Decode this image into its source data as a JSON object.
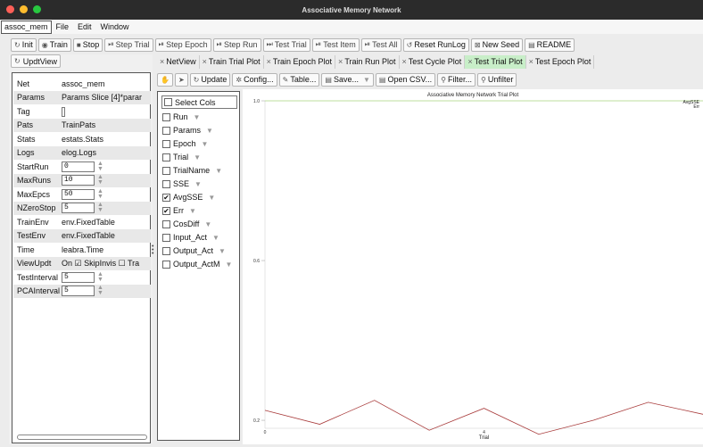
{
  "window": {
    "title": "Associative Memory Network"
  },
  "menu": {
    "app": "assoc_mem",
    "items": [
      "File",
      "Edit",
      "Window"
    ]
  },
  "toolbar": [
    {
      "icon": "refresh-icon",
      "glyph": "↻",
      "label": "Init",
      "enabled": true
    },
    {
      "icon": "play-icon",
      "glyph": "◉",
      "label": "Train",
      "enabled": true
    },
    {
      "icon": "stop-icon",
      "glyph": "■",
      "label": "Stop",
      "enabled": true
    },
    {
      "icon": "step-icon",
      "glyph": "⏯",
      "label": "Step Trial",
      "enabled": false
    },
    {
      "icon": "step-icon",
      "glyph": "⏯",
      "label": "Step Epoch",
      "enabled": false
    },
    {
      "icon": "step-icon",
      "glyph": "⏯",
      "label": "Step Run",
      "enabled": false
    },
    {
      "icon": "fast-forward-icon",
      "glyph": "⏭",
      "label": "Test Trial",
      "enabled": false
    },
    {
      "icon": "step-icon",
      "glyph": "⏯",
      "label": "Test Item",
      "enabled": false
    },
    {
      "icon": "step-icon",
      "glyph": "⏯",
      "label": "Test All",
      "enabled": false
    },
    {
      "icon": "reset-icon",
      "glyph": "↺",
      "label": "Reset RunLog",
      "enabled": true
    },
    {
      "icon": "seed-icon",
      "glyph": "⊠",
      "label": "New Seed",
      "enabled": true
    },
    {
      "icon": "file-icon",
      "glyph": "▤",
      "label": "README",
      "enabled": true
    }
  ],
  "updt_label": "UpdtView",
  "fields": [
    {
      "key": "Net",
      "value": "assoc_mem"
    },
    {
      "key": "Params",
      "value": "Params  Slice [4]*parar"
    },
    {
      "key": "Tag",
      "value": ""
    },
    {
      "key": "Pats",
      "value": "TrainPats"
    },
    {
      "key": "Stats",
      "value": "estats.Stats"
    },
    {
      "key": "Logs",
      "value": "elog.Logs"
    },
    {
      "key": "StartRun",
      "value": "0",
      "spin": true
    },
    {
      "key": "MaxRuns",
      "value": "10",
      "spin": true
    },
    {
      "key": "MaxEpcs",
      "value": "50",
      "spin": true
    },
    {
      "key": "NZeroStop",
      "value": "5",
      "spin": true
    },
    {
      "key": "TrainEnv",
      "value": "env.FixedTable"
    },
    {
      "key": "TestEnv",
      "value": "env.FixedTable"
    },
    {
      "key": "Time",
      "value": "leabra.Time"
    },
    {
      "key": "ViewUpdt",
      "value": "On ☑ SkipInvis ☐ Tra"
    },
    {
      "key": "TestInterval",
      "value": "5",
      "spin": true
    },
    {
      "key": "PCAInterval",
      "value": "5",
      "spin": true
    }
  ],
  "tabs": [
    {
      "label": "NetView",
      "active": false
    },
    {
      "label": "Train Trial Plot",
      "active": false
    },
    {
      "label": "Train Epoch Plot",
      "active": false
    },
    {
      "label": "Train Run Plot",
      "active": false
    },
    {
      "label": "Test Cycle Plot",
      "active": false
    },
    {
      "label": "Test Trial Plot",
      "active": true
    },
    {
      "label": "Test Epoch Plot",
      "active": false
    }
  ],
  "plot_toolbar": [
    {
      "icon": "pan-icon",
      "glyph": "✋",
      "label": ""
    },
    {
      "icon": "pointer-icon",
      "glyph": "➤",
      "label": ""
    },
    {
      "icon": "update-icon",
      "glyph": "↻",
      "label": "Update"
    },
    {
      "icon": "config-icon",
      "glyph": "✲",
      "label": "Config..."
    },
    {
      "icon": "table-icon",
      "glyph": "✎",
      "label": "Table..."
    },
    {
      "icon": "save-icon",
      "glyph": "▤",
      "label": "Save...",
      "dropdown": true
    },
    {
      "icon": "open-icon",
      "glyph": "▤",
      "label": "Open CSV..."
    },
    {
      "icon": "filter-icon",
      "glyph": "⚲",
      "label": "Filter..."
    },
    {
      "icon": "unfilter-icon",
      "glyph": "⚲",
      "label": "Unfilter"
    }
  ],
  "columns": {
    "select_label": "Select Cols",
    "items": [
      {
        "label": "Run",
        "checked": false
      },
      {
        "label": "Params",
        "checked": false
      },
      {
        "label": "Epoch",
        "checked": false
      },
      {
        "label": "Trial",
        "checked": false
      },
      {
        "label": "TrialName",
        "checked": false
      },
      {
        "label": "SSE",
        "checked": false
      },
      {
        "label": "AvgSSE",
        "checked": true
      },
      {
        "label": "Err",
        "checked": true
      },
      {
        "label": "CosDiff",
        "checked": false
      },
      {
        "label": "Input_Act",
        "checked": false
      },
      {
        "label": "Output_Act",
        "checked": false
      },
      {
        "label": "Output_ActM",
        "checked": false
      }
    ]
  },
  "chart_data": {
    "type": "line",
    "title": "Associative Memory Network Trial Plot",
    "xlabel": "Trial",
    "ylabel": "",
    "x_ticks": [
      "0",
      "4"
    ],
    "y_ticks": [
      "1.0",
      "0.6",
      "0.2"
    ],
    "xlim": [
      0,
      8
    ],
    "ylim": [
      0.18,
      1.0
    ],
    "series": [
      {
        "name": "AvgSSE",
        "color": "#7fbf3f",
        "x": [
          0,
          1,
          2,
          3,
          4,
          5,
          6,
          7,
          8
        ],
        "y": [
          1.0,
          1.0,
          1.0,
          1.0,
          1.0,
          1.0,
          1.0,
          1.0,
          1.0
        ]
      },
      {
        "name": "Err",
        "color": "#a83a3a",
        "x": [
          0,
          1,
          2,
          3,
          4,
          5,
          6,
          7,
          8
        ],
        "y": [
          0.225,
          0.19,
          0.25,
          0.175,
          0.23,
          0.165,
          0.2,
          0.245,
          0.215
        ]
      }
    ]
  }
}
